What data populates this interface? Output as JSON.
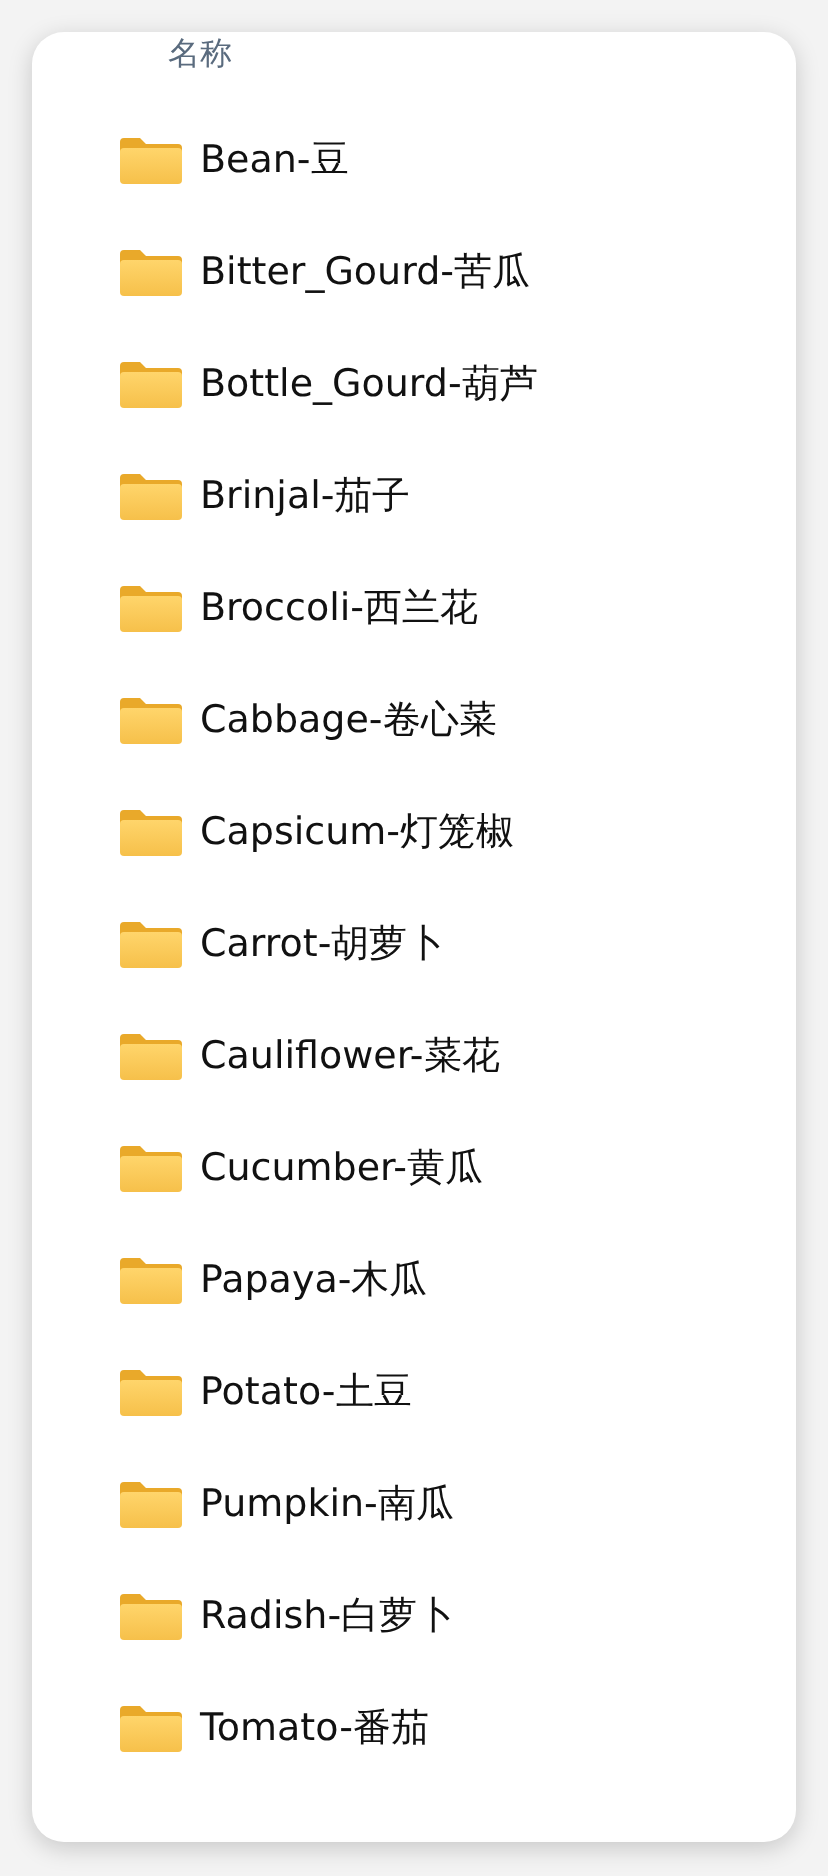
{
  "column_header": "名称",
  "folders": [
    {
      "name": "Bean-豆"
    },
    {
      "name": "Bitter_Gourd-苦瓜"
    },
    {
      "name": "Bottle_Gourd-葫芦"
    },
    {
      "name": "Brinjal-茄子"
    },
    {
      "name": "Broccoli-西兰花"
    },
    {
      "name": "Cabbage-卷心菜"
    },
    {
      "name": "Capsicum-灯笼椒"
    },
    {
      "name": "Carrot-胡萝卜"
    },
    {
      "name": "Cauliflower-菜花"
    },
    {
      "name": "Cucumber-黄瓜"
    },
    {
      "name": "Papaya-木瓜"
    },
    {
      "name": "Potato-土豆"
    },
    {
      "name": "Pumpkin-南瓜"
    },
    {
      "name": "Radish-白萝卜"
    },
    {
      "name": "Tomato-番茄"
    }
  ]
}
